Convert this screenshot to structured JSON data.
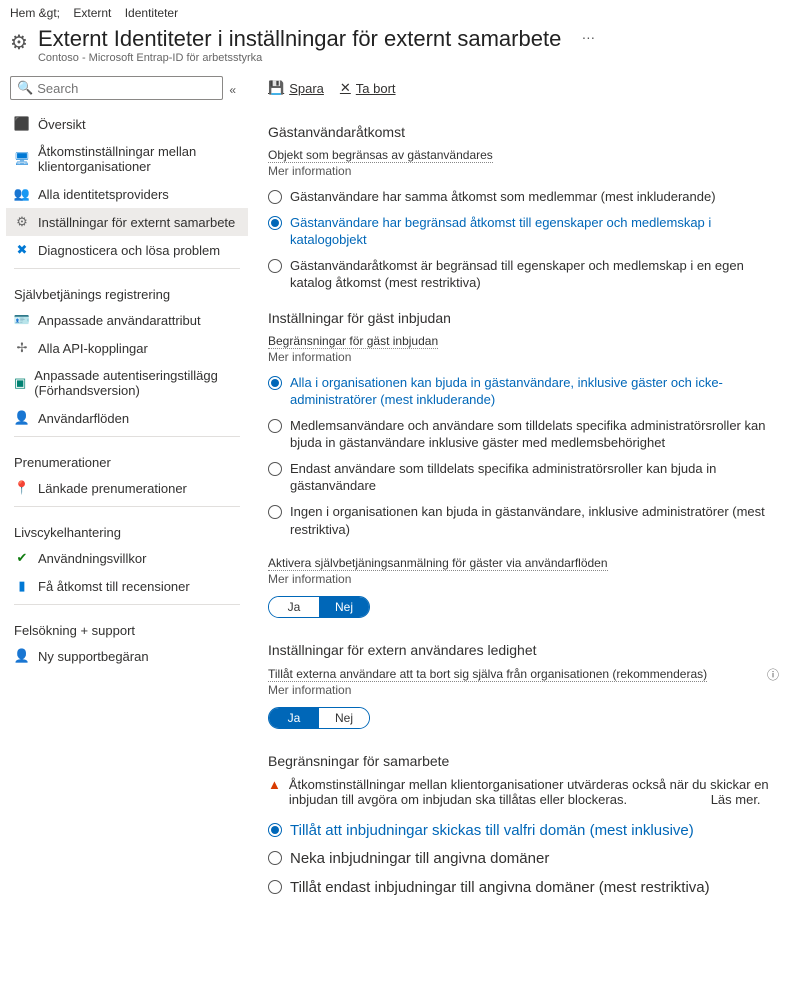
{
  "breadcrumb": [
    "Hem &gt;",
    "Externt",
    "Identiteter"
  ],
  "header": {
    "title": "Externt   Identiteter i inställningar för externt samarbete",
    "subtitle": "Contoso - Microsoft Entrap-ID för arbetsstyrka",
    "more": "…"
  },
  "search": {
    "placeholder": "Search"
  },
  "nav": {
    "items": [
      {
        "icon": "⬛",
        "cls": "c-blue",
        "label": "Översikt"
      },
      {
        "icon": "🖥",
        "cls": "c-blue",
        "label": "Åtkomstinställningar mellan klientorganisationer"
      },
      {
        "icon": "👥",
        "cls": "c-blue",
        "label": "Alla identitetsproviders"
      },
      {
        "icon": "⚙",
        "cls": "c-gray",
        "label": "Inställningar för externt samarbete",
        "selected": true
      },
      {
        "icon": "✖",
        "cls": "c-blue",
        "label": "Diagnosticera och lösa problem"
      }
    ],
    "sections": [
      {
        "label": "Självbetjänings registrering",
        "items": [
          {
            "icon": "🪪",
            "cls": "c-blue",
            "label": "Anpassade användarattribut"
          },
          {
            "icon": "✢",
            "cls": "c-gray",
            "label": "Alla API-kopplingar"
          },
          {
            "icon": "▣",
            "cls": "c-teal",
            "label": "Anpassade autentiseringstillägg (Förhandsversion)"
          },
          {
            "icon": "👤",
            "cls": "c-green",
            "label": "Användarflöden"
          }
        ]
      },
      {
        "label": "Prenumerationer",
        "items": [
          {
            "icon": "📍",
            "cls": "c-yellow",
            "label": "Länkade prenumerationer"
          }
        ]
      },
      {
        "label": "Livscykelhantering",
        "items": [
          {
            "icon": "✔",
            "cls": "c-green",
            "label": "Användningsvillkor"
          },
          {
            "icon": "▮",
            "cls": "c-blue",
            "label": "Få åtkomst till recensioner"
          }
        ]
      },
      {
        "label": "Felsökning + support",
        "items": [
          {
            "icon": "👤",
            "cls": "c-blue",
            "label": "Ny supportbegäran"
          }
        ]
      }
    ]
  },
  "toolbar": {
    "save": "Spara",
    "delete": "Ta bort"
  },
  "guestAccess": {
    "title": "Gästanvändaråtkomst",
    "desc": "Objekt som begränsas av gästanvändares",
    "more": "Mer information",
    "opts": [
      "Gästanvändare har samma åtkomst som medlemmar (mest inkluderande)",
      "Gästanvändare har begränsad åtkomst till egenskaper och medlemskap i katalogobjekt",
      "Gästanvändaråtkomst är begränsad till egenskaper och medlemskap i en egen katalog åtkomst (mest restriktiva)"
    ],
    "selected": 1
  },
  "guestInvite": {
    "title": "Inställningar för gäst inbjudan",
    "desc": "Begränsningar för gäst inbjudan",
    "more": "Mer information",
    "opts": [
      "Alla i organisationen kan bjuda in gästanvändare, inklusive gäster och icke-administratörer (mest inkluderande)",
      "Medlemsanvändare och användare som tilldelats specifika administratörsroller kan bjuda in gästanvändare inklusive gäster med medlemsbehörighet",
      "Endast användare som tilldelats specifika administratörsroller kan bjuda in gästanvändare",
      "Ingen i organisationen kan bjuda in gästanvändare, inklusive administratörer (mest restriktiva)"
    ],
    "selected": 0,
    "selfService": {
      "label": "Aktivera självbetjäningsanmälning för gäster via användarflöden",
      "more": "Mer information",
      "yes": "Ja",
      "no": "Nej",
      "value": "no"
    }
  },
  "leave": {
    "title": "Inställningar för extern användares ledighet",
    "desc": "Tillåt externa användare att ta bort sig själva från organisationen (rekommenderas)",
    "more": "Mer information",
    "yes": "Ja",
    "no": "Nej",
    "value": "yes"
  },
  "collab": {
    "title": "Begränsningar för samarbete",
    "warn": "Åtkomstinställningar mellan klientorganisationer utvärderas också när du skickar en inbjudan till avgöra om inbjudan ska tillåtas eller blockeras.",
    "readmore": "Läs mer.",
    "opts": [
      "Tillåt att inbjudningar skickas till valfri domän (mest inklusive)",
      "Neka inbjudningar till angivna domäner",
      "Tillåt endast inbjudningar till angivna domäner (mest restriktiva)"
    ],
    "selected": 0
  }
}
